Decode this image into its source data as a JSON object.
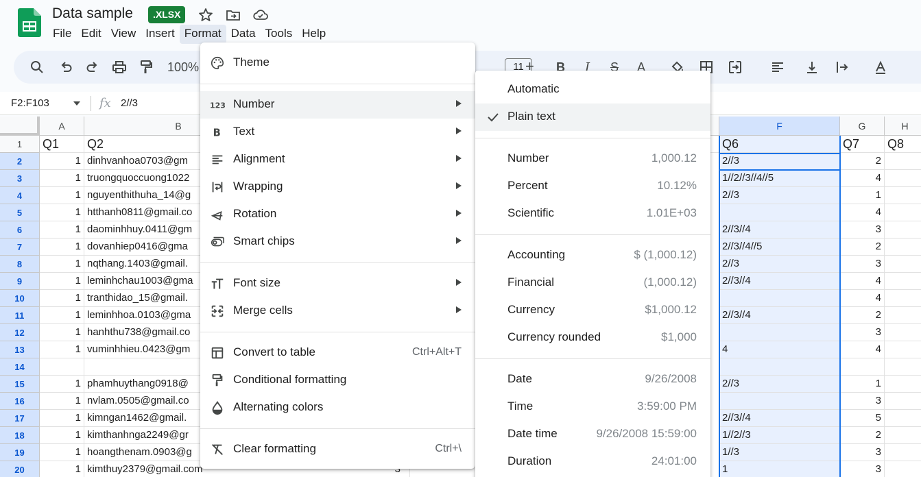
{
  "app": {
    "title": "Data sample",
    "badge": ".XLSX"
  },
  "menubar": [
    "File",
    "Edit",
    "View",
    "Insert",
    "Format",
    "Data",
    "Tools",
    "Help"
  ],
  "toolbar": {
    "zoom": "100%",
    "font_size": "11"
  },
  "formula_bar": {
    "name_box": "F2:F103",
    "fx": "fx",
    "value": "2//3"
  },
  "grid": {
    "columns": [
      "A",
      "B",
      "F",
      "G",
      "H"
    ],
    "rows": [
      "1",
      "2",
      "3",
      "4",
      "5",
      "6",
      "7",
      "8",
      "9",
      "10",
      "11",
      "12",
      "13",
      "14",
      "15",
      "16",
      "17",
      "18",
      "19",
      "20"
    ],
    "header_row": {
      "a": "Q1",
      "b": "Q2",
      "f": "Q6",
      "g": "Q7",
      "h": "Q8"
    },
    "col_a": [
      "1",
      "1",
      "1",
      "1",
      "1",
      "1",
      "1",
      "1",
      "1",
      "1",
      "1",
      "1",
      "",
      "1",
      "1",
      "1",
      "1",
      "1",
      "1"
    ],
    "col_b": [
      "dinhvanhoa0703@gm",
      "truongquoccuong1022",
      "nguyenthithuha_14@g",
      "htthanh0811@gmail.co",
      "daominhhuy.0411@gm",
      "dovanhiep0416@gma",
      "nqthang.1403@gmail.",
      "leminhchau1003@gma",
      "tranthidao_15@gmail.",
      "leminhhoa.0103@gma",
      "hanhthu738@gmail.co",
      "vuminhhieu.0423@gm",
      "",
      "phamhuythang0918@",
      "nvlam.0505@gmail.co",
      "kimngan1462@gmail.",
      "kimthanhnga2249@gr",
      "hoangthenam.0903@g",
      "kimthuy2379@gmail.com"
    ],
    "row20_extra": "3",
    "col_f": [
      "2//3",
      "1//2//3//4//5",
      "2//3",
      "",
      "2//3//4",
      "2//3//4//5",
      "2//3",
      "2//3//4",
      "",
      "2//3//4",
      "",
      "4",
      "",
      "2//3",
      "",
      "2//3//4",
      "1//2//3",
      "1//3",
      "1"
    ],
    "col_g": [
      "2",
      "4",
      "1",
      "4",
      "3",
      "2",
      "3",
      "4",
      "4",
      "2",
      "3",
      "4",
      "",
      "1",
      "3",
      "5",
      "2",
      "3",
      "3"
    ]
  },
  "format_menu": {
    "items": [
      {
        "label": "Theme",
        "icon": "palette-icon"
      },
      {
        "label": "Number",
        "icon": "number-123-icon"
      },
      {
        "label": "Text",
        "icon": "bold-b-icon"
      },
      {
        "label": "Alignment",
        "icon": "align-left-icon"
      },
      {
        "label": "Wrapping",
        "icon": "wrap-text-icon"
      },
      {
        "label": "Rotation",
        "icon": "text-rotation-icon"
      },
      {
        "label": "Smart chips",
        "icon": "smart-chip-icon"
      },
      {
        "label": "Font size",
        "icon": "font-size-icon"
      },
      {
        "label": "Merge cells",
        "icon": "merge-cells-icon"
      },
      {
        "label": "Convert to table",
        "icon": "table-icon",
        "shortcut": "Ctrl+Alt+T"
      },
      {
        "label": "Conditional formatting",
        "icon": "paint-roller-icon"
      },
      {
        "label": "Alternating colors",
        "icon": "droplet-icon"
      },
      {
        "label": "Clear formatting",
        "icon": "clear-format-icon",
        "shortcut": "Ctrl+\\"
      }
    ]
  },
  "number_submenu": {
    "items": [
      {
        "label": "Automatic",
        "sample": ""
      },
      {
        "label": "Plain text",
        "sample": "",
        "checked": true
      },
      {
        "label": "Number",
        "sample": "1,000.12"
      },
      {
        "label": "Percent",
        "sample": "10.12%"
      },
      {
        "label": "Scientific",
        "sample": "1.01E+03"
      },
      {
        "label": "Accounting",
        "sample": "$ (1,000.12)"
      },
      {
        "label": "Financial",
        "sample": "(1,000.12)"
      },
      {
        "label": "Currency",
        "sample": "$1,000.12"
      },
      {
        "label": "Currency rounded",
        "sample": "$1,000"
      },
      {
        "label": "Date",
        "sample": "9/26/2008"
      },
      {
        "label": "Time",
        "sample": "3:59:00 PM"
      },
      {
        "label": "Date time",
        "sample": "9/26/2008 15:59:00"
      },
      {
        "label": "Duration",
        "sample": "24:01:00"
      }
    ]
  },
  "colors": {
    "accent": "#1a73e8",
    "badge": "#188038",
    "selection": "#e8f0fe"
  }
}
